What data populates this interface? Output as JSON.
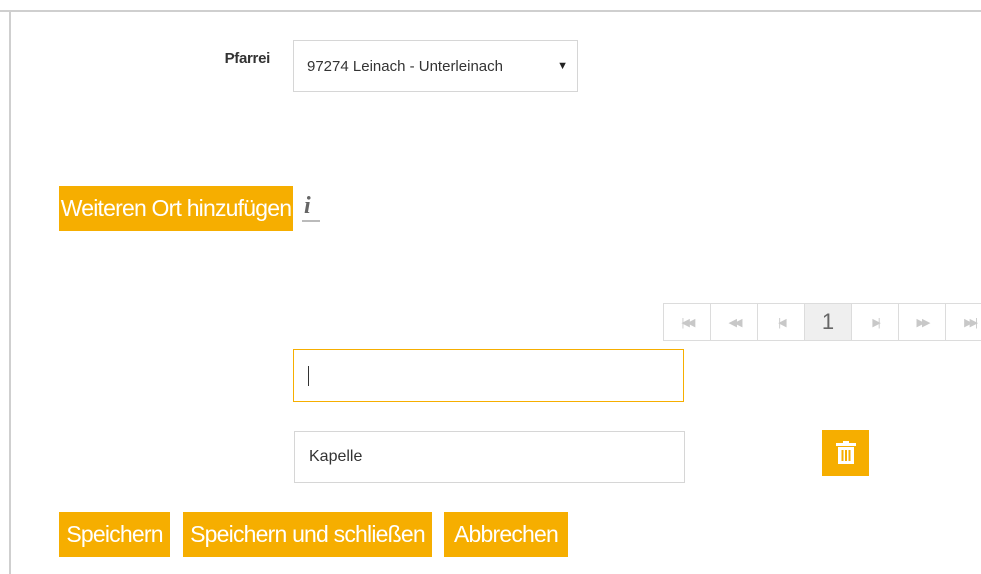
{
  "form": {
    "pfarrei_label": "Pfarrei",
    "pfarrei_value": "97274 Leinach - Unterleinach",
    "add_location_label": "Weiteren Ort hinzufügen",
    "new_location_value": "",
    "location_value": "Kapelle"
  },
  "pager": {
    "first": "⏮",
    "prev": "⏪",
    "prev_one": "◀",
    "current_page": "1",
    "next_one": "▶",
    "next": "⏩",
    "last": "⏭"
  },
  "actions": {
    "save_label": "Speichern",
    "save_close_label": "Speichern und schließen",
    "cancel_label": "Abbrechen"
  },
  "colors": {
    "accent": "#f6ae00",
    "border": "#d6d6d6"
  },
  "icons": {
    "info": "info-icon",
    "trash": "trash-icon",
    "dropdown": "chevron-down-icon"
  }
}
